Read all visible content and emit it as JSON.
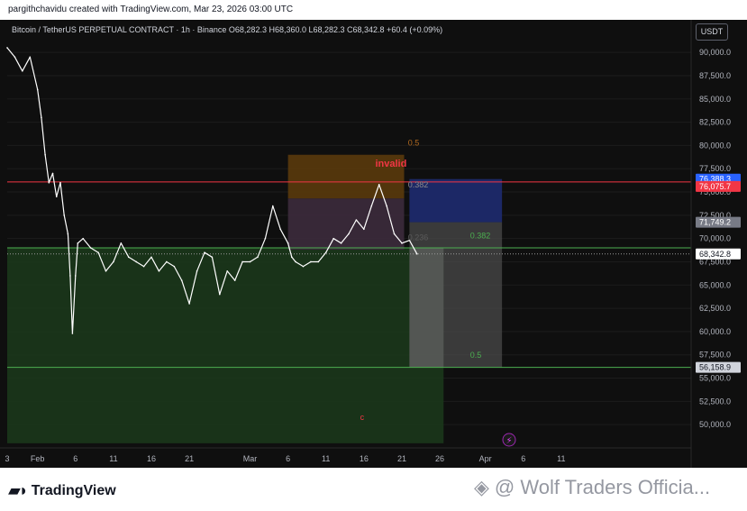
{
  "header": {
    "credit": "pargithchavidu created with TradingView.com, Mar 23, 2026 03:00 UTC"
  },
  "legend": {
    "text": "Bitcoin / TetherUS PERPETUAL CONTRACT · 1h · Binance  O68,282.3  H68,360.0  L68,282.3  C68,342.8  +60.4 (+0.09%)"
  },
  "currency_button": "USDT",
  "colors": {
    "background": "#0f0f0f",
    "price_line": "#ffffff",
    "red_line": "#f23645",
    "blue_box": "#1e2a6b",
    "green_zone": "#1b3a1b",
    "orange_box": "#5a3a0c",
    "purple_box": "#3a2a3a"
  },
  "chart_data": {
    "type": "line",
    "title": "",
    "xlabel": "",
    "ylabel": "",
    "ylim": [
      47500,
      93500
    ],
    "xlim_day": [
      -4,
      86
    ],
    "y_ticks": [
      {
        "value": 50000,
        "label": "50,000.0"
      },
      {
        "value": 52500,
        "label": "52,500.0"
      },
      {
        "value": 55000,
        "label": "55,000.0"
      },
      {
        "value": 57500,
        "label": "57,500.0"
      },
      {
        "value": 60000,
        "label": "60,000.0"
      },
      {
        "value": 62500,
        "label": "62,500.0"
      },
      {
        "value": 65000,
        "label": "65,000.0"
      },
      {
        "value": 67500,
        "label": "67,500.0"
      },
      {
        "value": 70000,
        "label": "70,000.0"
      },
      {
        "value": 72500,
        "label": "72,500.0"
      },
      {
        "value": 75000,
        "label": "75,000.0"
      },
      {
        "value": 77500,
        "label": "77,500.0"
      },
      {
        "value": 80000,
        "label": "80,000.0"
      },
      {
        "value": 82500,
        "label": "82,500.0"
      },
      {
        "value": 85000,
        "label": "85,000.0"
      },
      {
        "value": 87500,
        "label": "87,500.0"
      },
      {
        "value": 90000,
        "label": "90,000.0"
      }
    ],
    "x_ticks": [
      {
        "day": -4,
        "label": "3"
      },
      {
        "day": 0,
        "label": "Feb"
      },
      {
        "day": 5,
        "label": "6"
      },
      {
        "day": 10,
        "label": "11"
      },
      {
        "day": 15,
        "label": "16"
      },
      {
        "day": 20,
        "label": "21"
      },
      {
        "day": 28,
        "label": "Mar"
      },
      {
        "day": 33,
        "label": "6"
      },
      {
        "day": 38,
        "label": "11"
      },
      {
        "day": 43,
        "label": "16"
      },
      {
        "day": 48,
        "label": "21"
      },
      {
        "day": 53,
        "label": "26"
      },
      {
        "day": 59,
        "label": "Apr"
      },
      {
        "day": 64,
        "label": "6"
      },
      {
        "day": 69,
        "label": "11"
      }
    ],
    "series": [
      {
        "x_day": [
          -4,
          -3,
          -2,
          -1,
          0,
          0.5,
          1,
          1.5,
          2,
          2.5,
          3,
          3.5,
          4,
          4.3,
          4.6,
          5,
          5.3,
          6,
          7,
          8,
          9,
          10,
          11,
          12,
          13,
          14,
          15,
          16,
          17,
          18,
          19,
          20,
          21,
          22,
          23,
          24,
          25,
          26,
          27,
          28,
          29,
          30,
          31,
          32,
          33,
          33.5,
          34,
          35,
          36,
          37,
          38,
          39,
          40,
          41,
          42,
          43,
          44,
          45,
          46,
          47,
          48,
          49,
          50
        ],
        "y": [
          90500,
          89500,
          88000,
          89500,
          86000,
          83000,
          79000,
          76000,
          77000,
          74500,
          76000,
          72500,
          70500,
          66000,
          59800,
          66000,
          69500,
          70000,
          69000,
          68500,
          66500,
          67500,
          69500,
          68000,
          67500,
          67000,
          68000,
          66500,
          67500,
          67000,
          65500,
          63000,
          66500,
          68500,
          68000,
          64000,
          66500,
          65500,
          67500,
          67500,
          68000,
          70000,
          73500,
          71000,
          69500,
          68000,
          67500,
          67000,
          67500,
          67500,
          68500,
          70000,
          69500,
          70500,
          72000,
          71000,
          73500,
          75800,
          73500,
          70500,
          69500,
          69800,
          68342.8
        ]
      }
    ],
    "horizontal_lines": [
      {
        "value": 76075.7,
        "color": "#f23645"
      },
      {
        "value": 69000,
        "color": "#4caf50"
      },
      {
        "value": 56158.9,
        "color": "#4caf50"
      }
    ],
    "zones": [
      {
        "name": "green",
        "x0": -4,
        "x1": 53.5,
        "y0": 48000,
        "y1": 69000
      },
      {
        "name": "orange",
        "x0": 33,
        "x1": 48.3,
        "y0": 74300,
        "y1": 79000
      },
      {
        "name": "purple",
        "x0": 33,
        "x1": 48.3,
        "y0": 68800,
        "y1": 74300
      },
      {
        "name": "blue",
        "x0": 49,
        "x1": 61.2,
        "y0": 71749.2,
        "y1": 76388.3
      },
      {
        "name": "gray",
        "x0": 49,
        "x1": 61.2,
        "y0": 56158.9,
        "y1": 71749.2
      },
      {
        "name": "gray2",
        "x0": 49,
        "x1": 53.5,
        "y0": 56158.9,
        "y1": 69000
      }
    ],
    "annotations": [
      {
        "text": "0.5",
        "x_day": 48.8,
        "value": 80000,
        "color": "#b36a1f"
      },
      {
        "text": "invalid",
        "x_day": 44.5,
        "value": 77700,
        "color": "#f23645"
      },
      {
        "text": "0.382",
        "x_day": 48.8,
        "value": 75500,
        "color": "#8a8a8a"
      },
      {
        "text": "0.236",
        "x_day": 48.8,
        "value": 69800,
        "color": "#5a5a5a"
      },
      {
        "text": "0.382",
        "x_day": 57,
        "value": 70000,
        "color": "#4caf50"
      },
      {
        "text": "0.5",
        "x_day": 57,
        "value": 57200,
        "color": "#4caf50"
      },
      {
        "text": "c",
        "x_day": 42.5,
        "value": 50500,
        "color": "#f23645"
      }
    ],
    "price_labels": [
      {
        "text": "76,388.3",
        "value": 76388.3,
        "bg": "#2962ff",
        "fg": "#ffffff"
      },
      {
        "text": "76,075.7",
        "value": 75600,
        "bg": "#f23645",
        "fg": "#ffffff"
      },
      {
        "text": "71,749.2",
        "value": 71749.2,
        "bg": "#787b86",
        "fg": "#ffffff"
      },
      {
        "text": "68,342.8",
        "value": 68342.8,
        "bg": "#ffffff",
        "fg": "#131722"
      },
      {
        "text": "56,158.9",
        "value": 56158.9,
        "bg": "#d1d4dc",
        "fg": "#131722"
      }
    ]
  },
  "footer": {
    "brand": "TradingView",
    "watermark": "@ Wolf Traders Officia..."
  }
}
